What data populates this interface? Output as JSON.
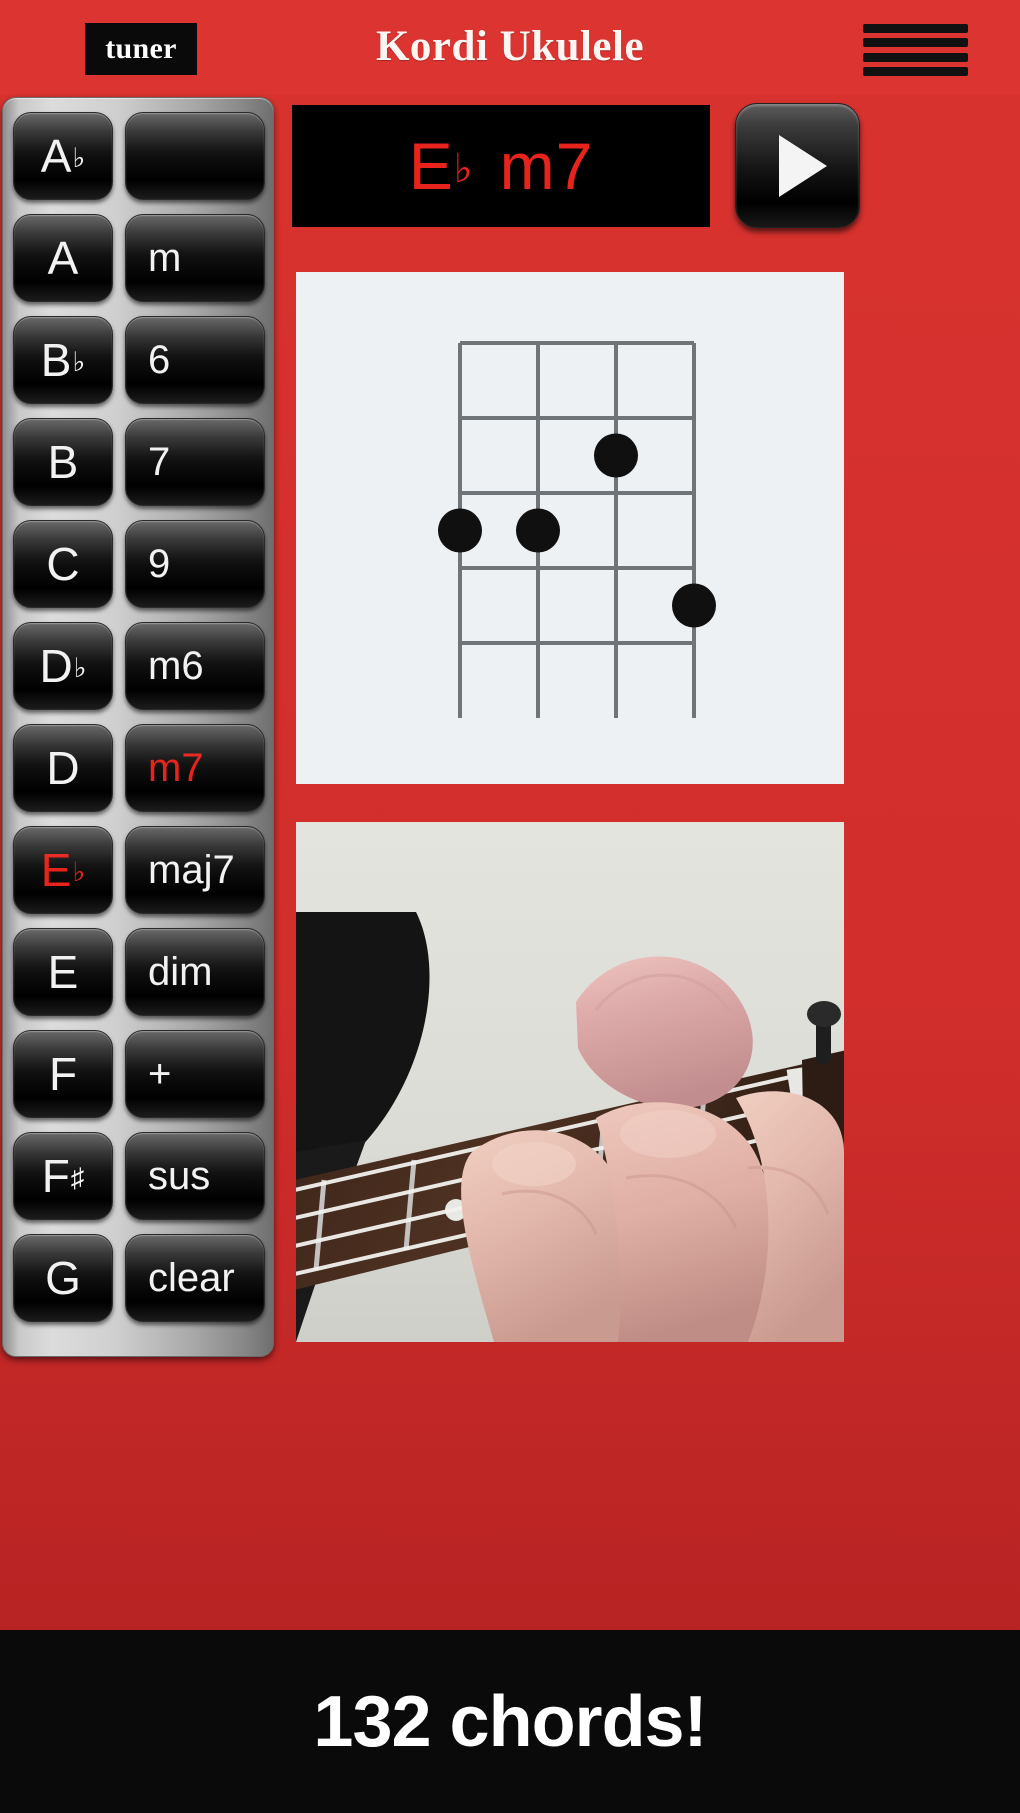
{
  "header": {
    "tuner_label": "tuner",
    "title": "Kordi Ukulele",
    "menu_icon": "hamburger-menu-icon"
  },
  "chord_display": {
    "root": "E",
    "accidental": "♭",
    "quality": "m7",
    "full_text": "E♭ m7",
    "text_color": "#e8231c",
    "background": "#000000"
  },
  "play_button": {
    "icon": "play-triangle-icon",
    "label": "Play chord"
  },
  "keypad": {
    "notes": [
      {
        "label": "A",
        "accidental": "♭",
        "selected": false
      },
      {
        "label": "A",
        "accidental": "",
        "selected": false
      },
      {
        "label": "B",
        "accidental": "♭",
        "selected": false
      },
      {
        "label": "B",
        "accidental": "",
        "selected": false
      },
      {
        "label": "C",
        "accidental": "",
        "selected": false
      },
      {
        "label": "D",
        "accidental": "♭",
        "selected": false
      },
      {
        "label": "D",
        "accidental": "",
        "selected": false
      },
      {
        "label": "E",
        "accidental": "♭",
        "selected": true
      },
      {
        "label": "E",
        "accidental": "",
        "selected": false
      },
      {
        "label": "F",
        "accidental": "",
        "selected": false
      },
      {
        "label": "F",
        "accidental": "♯",
        "selected": false
      },
      {
        "label": "G",
        "accidental": "",
        "selected": false
      }
    ],
    "modifiers": [
      {
        "label": "",
        "selected": false
      },
      {
        "label": "m",
        "selected": false
      },
      {
        "label": "6",
        "selected": false
      },
      {
        "label": "7",
        "selected": false
      },
      {
        "label": "9",
        "selected": false
      },
      {
        "label": "m6",
        "selected": false
      },
      {
        "label": "m7",
        "selected": true
      },
      {
        "label": "maj7",
        "selected": false
      },
      {
        "label": "dim",
        "selected": false
      },
      {
        "label": "+",
        "selected": false
      },
      {
        "label": "sus",
        "selected": false
      },
      {
        "label": "clear",
        "selected": false
      }
    ],
    "selected_color": "#e8231c",
    "default_color": "#f2f2f2"
  },
  "chord_diagram": {
    "type": "ukulele-chord-diagram",
    "strings": 4,
    "frets": 5,
    "dots": [
      {
        "string": 1,
        "fret": 3
      },
      {
        "string": 2,
        "fret": 3
      },
      {
        "string": 3,
        "fret": 2
      },
      {
        "string": 4,
        "fret": 4
      }
    ],
    "background": "#eef1f4",
    "line_color": "#6f7479",
    "dot_color": "#101010"
  },
  "photo": {
    "alt": "ukulele-fretting-hand-photo",
    "description": "Close-up photo of a hand fretting an E♭m7 chord on a ukulele neck"
  },
  "footer": {
    "text": "132 chords!",
    "background": "#0a0a0a",
    "text_color": "#ffffff"
  },
  "theme": {
    "brand_red": "#d22f2f",
    "accent_red": "#e8231c",
    "panel_black": "#000000"
  }
}
